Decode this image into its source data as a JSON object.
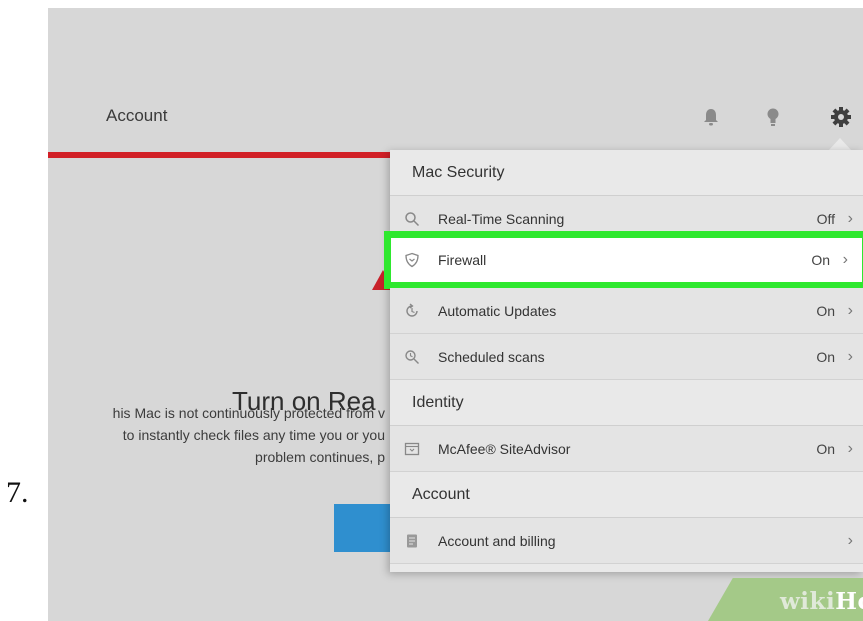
{
  "step": {
    "number": "7."
  },
  "header": {
    "title": "Account",
    "icons": [
      "bell-icon",
      "lightbulb-icon",
      "gear-icon"
    ]
  },
  "main": {
    "heading": "Turn on Rea",
    "body_lines": [
      "his Mac is not continuously protected from v",
      "to instantly check files any time you or you",
      "problem continues, p"
    ]
  },
  "menu": {
    "sections": [
      {
        "title": "Mac Security"
      },
      {
        "title": "Identity"
      },
      {
        "title": "Account"
      }
    ],
    "items": [
      {
        "label": "Real-Time Scanning",
        "status": "Off",
        "icon": "search-icon"
      },
      {
        "label": "Firewall",
        "status": "On",
        "icon": "shield-icon"
      },
      {
        "label": "Automatic Updates",
        "status": "On",
        "icon": "refresh-icon"
      },
      {
        "label": "Scheduled scans",
        "status": "On",
        "icon": "scan-icon"
      },
      {
        "label": "McAfee® SiteAdvisor",
        "status": "On",
        "icon": "browser-icon"
      },
      {
        "label": "Account and billing",
        "status": "",
        "icon": "document-icon"
      }
    ]
  },
  "watermark": {
    "wiki": "wiki",
    "how": "How"
  },
  "colors": {
    "accent_red": "#d11f26",
    "highlight_green": "#2ee82e",
    "button_blue": "#2f8fcf"
  }
}
